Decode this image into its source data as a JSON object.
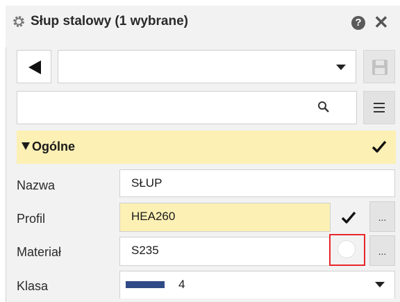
{
  "window": {
    "title": "Słup stalowy (1 wybrane)",
    "help_icon": "question-circle-icon",
    "close_icon": "close-icon",
    "help_glyph": "?",
    "close_glyph": "✕"
  },
  "toolbar": {
    "preset_value": "",
    "search_value": "",
    "search_placeholder": ""
  },
  "section": {
    "title": "Ogólne",
    "expanded": true
  },
  "properties": [
    {
      "label": "Nazwa",
      "value": "SŁUP"
    },
    {
      "label": "Profil",
      "value": "HEA260"
    },
    {
      "label": "Materiał",
      "value": "S235"
    },
    {
      "label": "Klasa",
      "value": "4",
      "swatch_color": "#2f4a86"
    }
  ],
  "dots_label": "...",
  "colors": {
    "accent_yellow": "#fcf0b4",
    "highlight_red": "#e8262a",
    "panel_bg": "#f2f2f2"
  }
}
